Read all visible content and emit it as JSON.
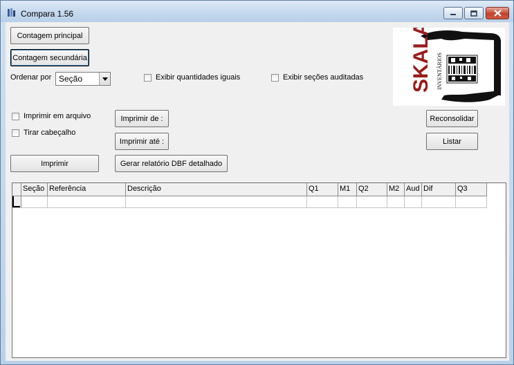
{
  "window": {
    "title": "Compara 1.56",
    "icon": "app-icon",
    "controls": [
      "minimize-icon",
      "maximize-icon",
      "close-icon"
    ]
  },
  "buttons": {
    "contagem_principal": "Contagem principal",
    "contagem_secundaria": "Contagem secundária",
    "imprimir_de": "Imprimir de :",
    "imprimir_ate": "Imprimir até :",
    "imprimir": "Imprimir",
    "gerar_relatorio": "Gerar relatório DBF detalhado",
    "reconsolidar": "Reconsolidar",
    "listar": "Listar"
  },
  "sort": {
    "label": "Ordenar por",
    "selected": "Seção"
  },
  "checkboxes": {
    "exibir_quantidades_iguais": {
      "label": "Exibir quantidades iguais",
      "checked": false
    },
    "exibir_secoes_auditadas": {
      "label": "Exibir seções auditadas",
      "checked": false
    },
    "imprimir_em_arquivo": {
      "label": "Imprimir em arquivo",
      "checked": false
    },
    "tirar_cabecalho": {
      "label": "Tirar cabeçalho",
      "checked": false
    }
  },
  "logo": {
    "brand": "SKALA",
    "tagline": "INVENTÁRIOS",
    "brand_color": "#9b1b1b"
  },
  "grid": {
    "columns": [
      {
        "label": "Seção"
      },
      {
        "label": "Referência"
      },
      {
        "label": "Descrição"
      },
      {
        "label": "Q1"
      },
      {
        "label": "M1"
      },
      {
        "label": "Q2"
      },
      {
        "label": "M2"
      },
      {
        "label": "Aud"
      },
      {
        "label": "Dif"
      },
      {
        "label": "Q3"
      }
    ],
    "rows": [
      [
        "",
        "",
        "",
        "",
        "",
        "",
        "",
        "",
        "",
        ""
      ]
    ]
  }
}
